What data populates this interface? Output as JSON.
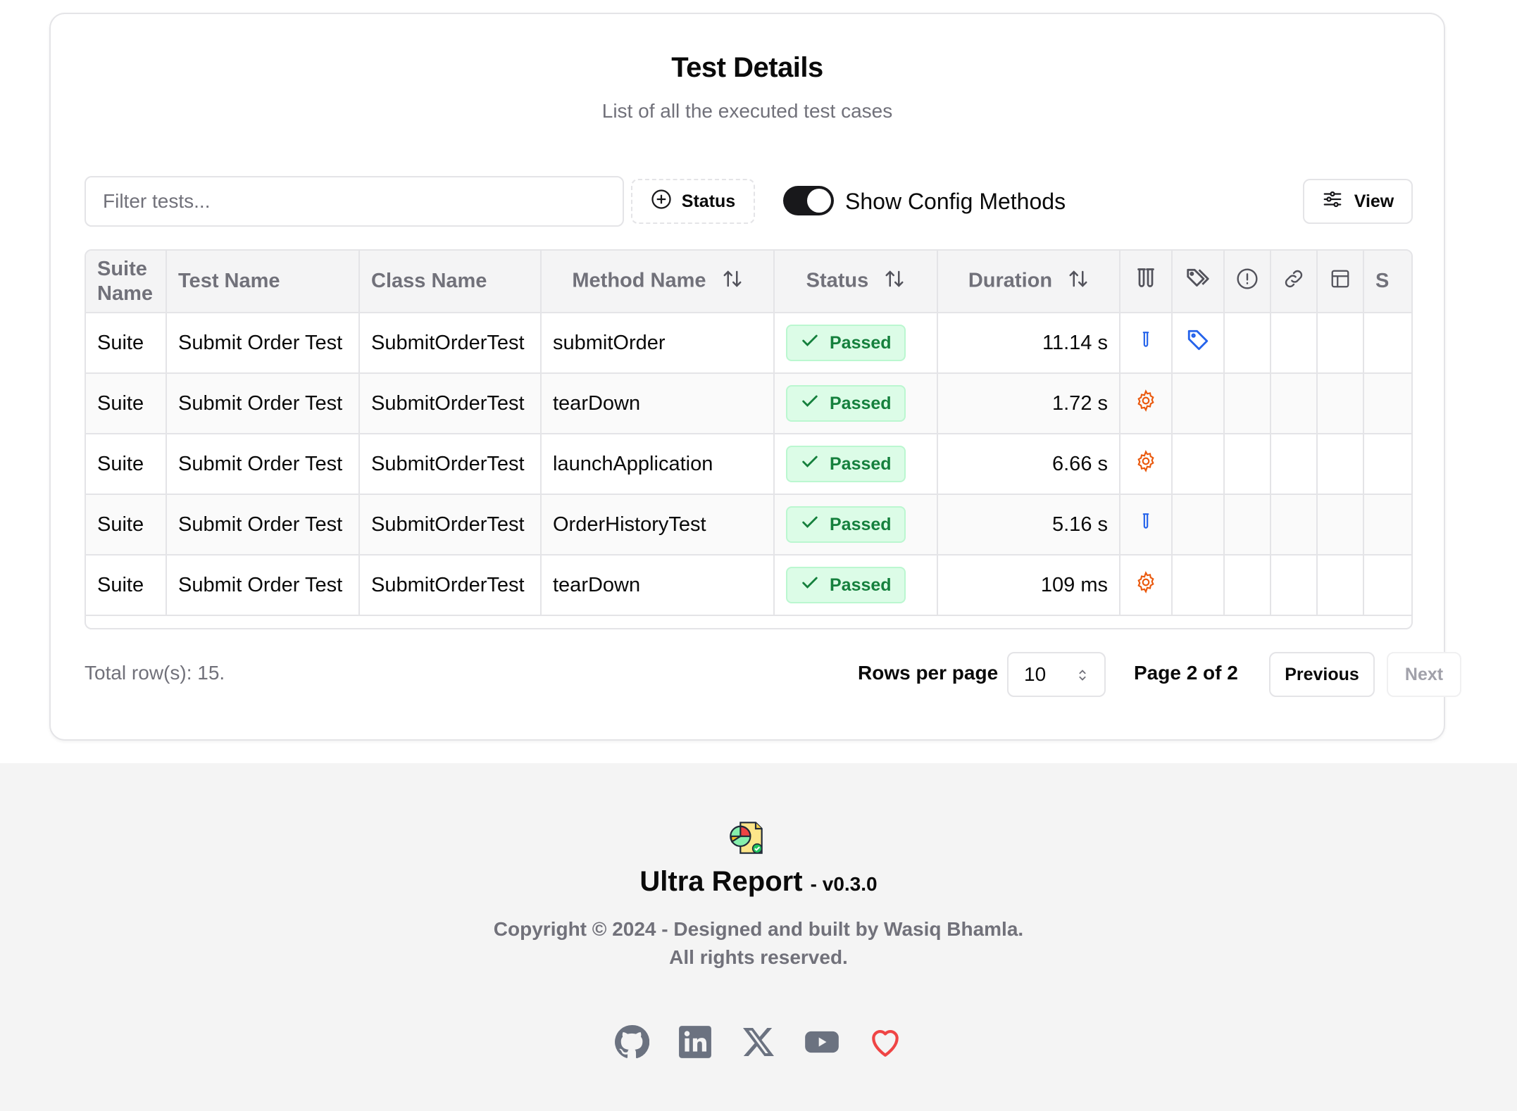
{
  "header": {
    "title": "Test Details",
    "subtitle": "List of all the executed test cases"
  },
  "toolbar": {
    "filter_placeholder": "Filter tests...",
    "status_label": "Status",
    "toggle_label": "Show Config Methods",
    "toggle_on": true,
    "view_label": "View"
  },
  "table": {
    "columns": {
      "suite_line1": "Suite",
      "suite_line2": "Name",
      "test_name": "Test Name",
      "class_name": "Class Name",
      "method_name": "Method Name",
      "status": "Status",
      "duration": "Duration",
      "truncated": "S"
    },
    "rows": [
      {
        "suite": "Suite",
        "test": "Submit Order Test",
        "class": "SubmitOrderTest",
        "method": "submitOrder",
        "status": "Passed",
        "duration": "11.14 s",
        "type_icon": "test-tube-icon",
        "has_tag": true
      },
      {
        "suite": "Suite",
        "test": "Submit Order Test",
        "class": "SubmitOrderTest",
        "method": "tearDown",
        "status": "Passed",
        "duration": "1.72 s",
        "type_icon": "gear-icon",
        "has_tag": false
      },
      {
        "suite": "Suite",
        "test": "Submit Order Test",
        "class": "SubmitOrderTest",
        "method": "launchApplication",
        "status": "Passed",
        "duration": "6.66 s",
        "type_icon": "gear-icon",
        "has_tag": false
      },
      {
        "suite": "Suite",
        "test": "Submit Order Test",
        "class": "SubmitOrderTest",
        "method": "OrderHistoryTest",
        "status": "Passed",
        "duration": "5.16 s",
        "type_icon": "test-tube-icon",
        "has_tag": false
      },
      {
        "suite": "Suite",
        "test": "Submit Order Test",
        "class": "SubmitOrderTest",
        "method": "tearDown",
        "status": "Passed",
        "duration": "109 ms",
        "type_icon": "gear-icon",
        "has_tag": false
      }
    ]
  },
  "pagination": {
    "total": "Total row(s): 15.",
    "rows_per_page_label": "Rows per page",
    "rows_per_page_value": "10",
    "page_info": "Page 2 of 2",
    "previous": "Previous",
    "next": "Next"
  },
  "footer": {
    "brand": "Ultra Report",
    "version": "- v0.3.0",
    "copyright_line1": "Copyright © 2024 - Designed and built by Wasiq Bhamla.",
    "copyright_line2": "All rights reserved.",
    "socials": [
      "github-icon",
      "linkedin-icon",
      "x-icon",
      "youtube-icon",
      "heart-icon"
    ]
  },
  "colors": {
    "passed_bg": "#dcfce7",
    "passed_text": "#15803d",
    "test_icon": "#2563eb",
    "config_icon": "#ea580c",
    "heart": "#ef4444"
  }
}
